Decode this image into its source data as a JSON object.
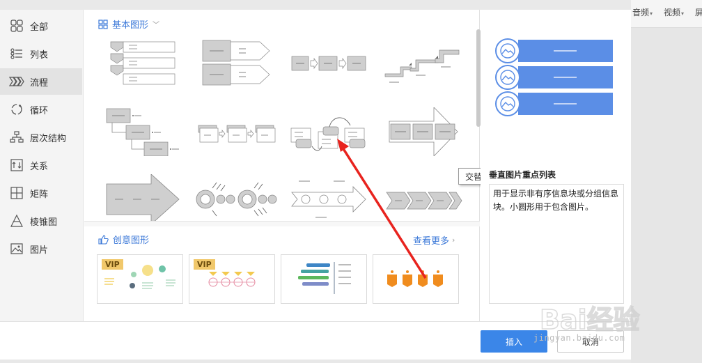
{
  "ribbon": {
    "audio_label": "音频",
    "video_label": "视频",
    "partial_label": "屏"
  },
  "sidebar": {
    "items": [
      {
        "label": "全部",
        "icon": "grid-icon"
      },
      {
        "label": "列表",
        "icon": "list-icon"
      },
      {
        "label": "流程",
        "icon": "process-icon",
        "active": true
      },
      {
        "label": "循环",
        "icon": "cycle-icon"
      },
      {
        "label": "层次结构",
        "icon": "hierarchy-icon"
      },
      {
        "label": "关系",
        "icon": "relationship-icon"
      },
      {
        "label": "矩阵",
        "icon": "matrix-icon"
      },
      {
        "label": "棱锥图",
        "icon": "pyramid-icon"
      },
      {
        "label": "图片",
        "icon": "picture-icon"
      }
    ]
  },
  "basic": {
    "title": "基本图形"
  },
  "creative": {
    "title": "创意图形",
    "more_label": "查看更多",
    "vip_label": "VIP"
  },
  "tooltip": {
    "text": "交替流"
  },
  "preview": {
    "title": "垂直图片重点列表",
    "description": "用于显示非有序信息块或分组信息块。小圆形用于包含图片。"
  },
  "footer": {
    "insert_label": "插入",
    "cancel_label": "取消"
  },
  "watermark": {
    "text": "Bai经验",
    "url": "jingyan.baidu.com"
  },
  "colors": {
    "accent": "#3b78d8",
    "insert_button": "#3b86e8",
    "annotation": "#e8231e",
    "preview_block": "#5b8ee6"
  }
}
